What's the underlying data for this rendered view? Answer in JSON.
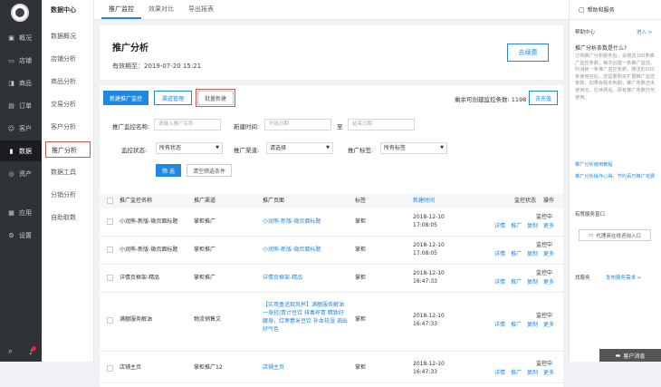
{
  "nav": {
    "items": [
      {
        "icon": "▣",
        "label": "概况"
      },
      {
        "icon": "▭",
        "label": "店铺"
      },
      {
        "icon": "◨",
        "label": "商品"
      },
      {
        "icon": "▤",
        "label": "订单"
      },
      {
        "icon": "☺",
        "label": "客户"
      },
      {
        "icon": "▮",
        "label": "数据"
      },
      {
        "icon": "◎",
        "label": "资产"
      },
      {
        "icon": "▦",
        "label": "应用"
      },
      {
        "icon": "⚙",
        "label": "设置"
      }
    ]
  },
  "subnav": {
    "header": "数据中心",
    "items": [
      "数据概况",
      "店铺分析",
      "商品分析",
      "交易分析",
      "客户分析",
      "推广分析",
      "数据工具",
      "分销分析",
      "自助取数"
    ]
  },
  "tabs": [
    "推广监控",
    "效果对比",
    "导出报表"
  ],
  "page": {
    "title": "推广分析",
    "expire": "有效期至：2019-07-20 15:21",
    "renew": "去续费"
  },
  "toolbar": {
    "new_monitor": "新建推广监控",
    "channel_mgmt": "渠道管理",
    "batch_new": "批量新建",
    "remaining": "剩余可创建监控条数: 1198",
    "recharge": "去充值"
  },
  "filters": {
    "name_label": "推广监控名称:",
    "name_placeholder": "请输入推广名称",
    "time_label": "新建时间:",
    "start_placeholder": "开始日期",
    "to": "至",
    "end_placeholder": "结束日期",
    "status_label": "监控状态:",
    "status_value": "所有状态",
    "channel_label": "推广渠道:",
    "channel_value": "请选择",
    "tag_label": "推广标签:",
    "tag_value": "所有标签",
    "filter_btn": "筛 选",
    "clear_btn": "清空筛选条件"
  },
  "table": {
    "headers": [
      "推广监控名称",
      "推广渠道",
      "推广页面",
      "标签",
      "新建时间",
      "监控状态",
      "操作"
    ],
    "rows": [
      {
        "name": "小润熊-新版-微页面标题",
        "channel": "掌柜推广",
        "page": "小润熊-新版-微页面标题",
        "tag": "掌柜",
        "date": "2018-12-10",
        "time": "17:08:05",
        "status": "监控中"
      },
      {
        "name": "小润熊-新版-微页面标题",
        "channel": "掌柜推广",
        "page": "小润熊-新版-微页面标题",
        "tag": "掌柜",
        "date": "2018-12-10",
        "time": "17:08:05",
        "status": "监控中"
      },
      {
        "name": "详情页框架-精品",
        "channel": "掌柜推广",
        "page": "详情页框架-精品",
        "tag": "掌柜",
        "date": "2018-12-10",
        "time": "16:47:33",
        "status": "监控中"
      },
      {
        "name": "满额服务解油",
        "channel": "物流销售文",
        "page": "【实用盒适观风杯】满额服务解油一身轻|青计豆饮 排毒养青 精致好腰身，红枣薏米豆饮 补血祛湿 调出好气色",
        "tag": "掌柜",
        "date": "2018-12-10",
        "time": "16:47:33",
        "status": "监控中"
      },
      {
        "name": "店铺主页",
        "channel": "掌柜推广12",
        "page": "店铺主页",
        "tag": "掌柜",
        "date": "2018-12-10",
        "time": "16:47:33",
        "status": "监控中"
      }
    ],
    "actions": [
      "详情",
      "推广",
      "复制",
      "更多"
    ]
  },
  "help": {
    "header": "帮助和服务",
    "center_title": "帮助中心",
    "enter": "进入 >",
    "faq_title": "推广分析条数是什么?",
    "faq_text": "订购推广分析服务后，会赠送100条推广监控条数，每次创建一条推广监控，所消耗一条推广监控条数，赠送的100条使用完后，您需要购买扩展推广监控条数。如果有服务到期，推广条数还未使用完，在续费后，原有推广条数仍可使用。",
    "link1": "推广分析使用教程",
    "link2": "推广分析操作心得，节约百万推广花费",
    "service_title": "有赞服务窗口",
    "service_btn": "代理商在线咨询入口",
    "find_title": "找服务",
    "find_link": "发布服务需求 >",
    "chat": "客户消息"
  }
}
